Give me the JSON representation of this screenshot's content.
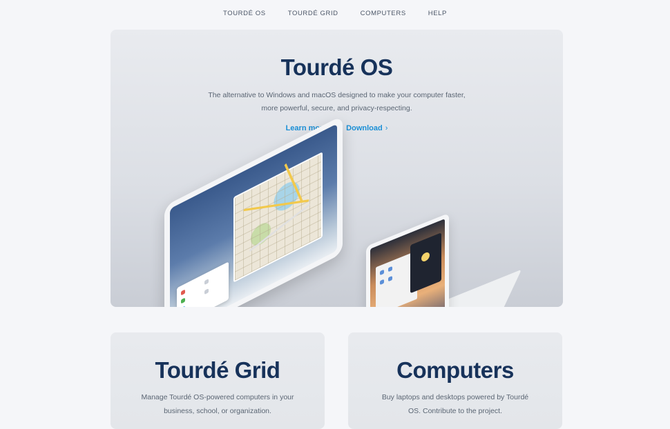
{
  "nav": {
    "items": [
      {
        "label": "TOURDÉ OS"
      },
      {
        "label": "TOURDÉ GRID"
      },
      {
        "label": "COMPUTERS"
      },
      {
        "label": "HELP"
      }
    ]
  },
  "hero": {
    "title": "Tourdé OS",
    "description": "The alternative to Windows and macOS designed to make your computer faster, more powerful, secure, and privacy-respecting.",
    "links": [
      {
        "label": "Learn more",
        "icon": "chevron-right-icon",
        "glyph": "›"
      },
      {
        "label": "Download",
        "icon": "chevron-right-icon",
        "glyph": "›"
      }
    ]
  },
  "cards": {
    "grid": {
      "title": "Tourdé Grid",
      "description": "Manage Tourdé OS-powered computers in your business, school, or organization."
    },
    "computers": {
      "title": "Computers",
      "description": "Buy laptops and desktops powered by Tourdé OS. Contribute to the project."
    }
  },
  "colors": {
    "page_bg": "#f5f6f9",
    "title": "#17325a",
    "link": "#1a8fd6",
    "body_text": "#5a6573"
  }
}
